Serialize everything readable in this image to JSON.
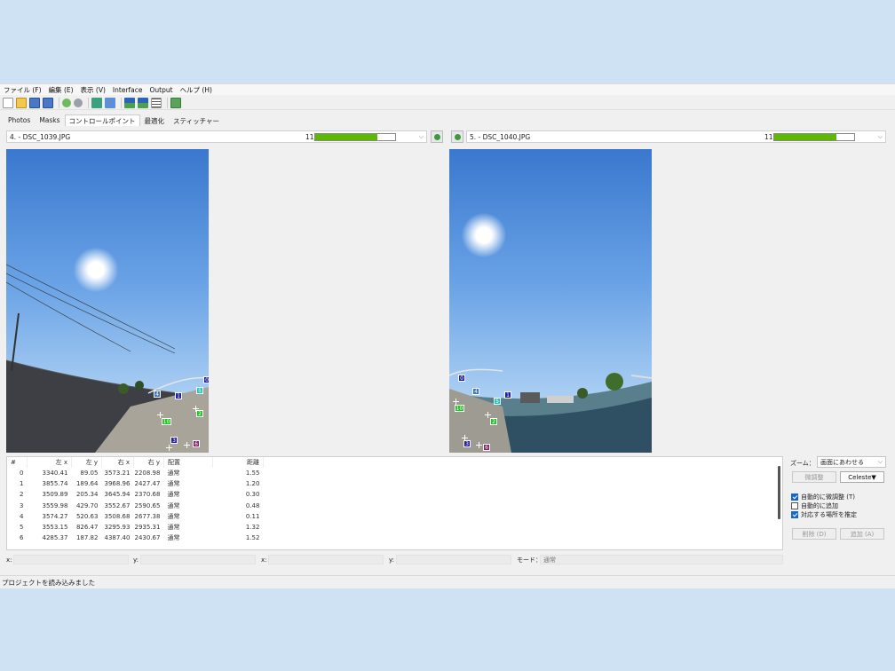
{
  "menu": [
    "ファイル (F)",
    "編集 (E)",
    "表示 (V)",
    "Interface",
    "Output",
    "ヘルプ (H)"
  ],
  "tabs": [
    "Photos",
    "Masks",
    "コントロールポイント",
    "最適化",
    "スティッチャー"
  ],
  "left_image": {
    "name": "4. - DSC_1039.JPG",
    "count": "11",
    "progress": 0.78
  },
  "right_image": {
    "name": "5. - DSC_1040.JPG",
    "count": "11",
    "progress": 0.78
  },
  "left_points": [
    "0",
    "4",
    "1",
    "5",
    "2",
    "3",
    "6",
    "10"
  ],
  "right_points": [
    "0",
    "4",
    "1",
    "5",
    "3",
    "2",
    "6",
    "10"
  ],
  "table": {
    "headers": [
      "#",
      "左 x",
      "左 y",
      "右 x",
      "右 y",
      "配置",
      "距離"
    ],
    "rows": [
      [
        "0",
        "3340.41",
        "89.05",
        "3573.21",
        "2208.98",
        "通常",
        "1.55"
      ],
      [
        "1",
        "3855.74",
        "189.64",
        "3968.96",
        "2427.47",
        "通常",
        "1.20"
      ],
      [
        "2",
        "3509.89",
        "205.34",
        "3645.94",
        "2370.68",
        "通常",
        "0.30"
      ],
      [
        "3",
        "3559.98",
        "429.70",
        "3552.67",
        "2590.65",
        "通常",
        "0.48"
      ],
      [
        "4",
        "3574.27",
        "520.63",
        "3508.68",
        "2677.38",
        "通常",
        "0.11"
      ],
      [
        "5",
        "3553.15",
        "826.47",
        "3295.93",
        "2935.31",
        "通常",
        "1.32"
      ],
      [
        "6",
        "4285.37",
        "187.82",
        "4387.40",
        "2430.67",
        "通常",
        "1.52"
      ]
    ]
  },
  "coords": {
    "x1": "x:",
    "y1": "y:",
    "x2": "x:",
    "y2": "y:",
    "mode_label": "モード：",
    "mode_value": "通常"
  },
  "right_panel": {
    "zoom_label": "ズーム：",
    "zoom_value": "画面にあわせる",
    "fine_tune": "微調整",
    "celeste": "Celeste▼",
    "check_auto_fine": "自動的に微調整 (T)",
    "check_auto_add": "自動的に追加",
    "check_estimate": "対応する場所を推定",
    "delete": "削除 (D)",
    "add": "追加 (A)"
  },
  "status": "プロジェクトを読み込みました",
  "colors": {
    "accent": "#5cb800",
    "checkbox": "#1a66c8"
  }
}
